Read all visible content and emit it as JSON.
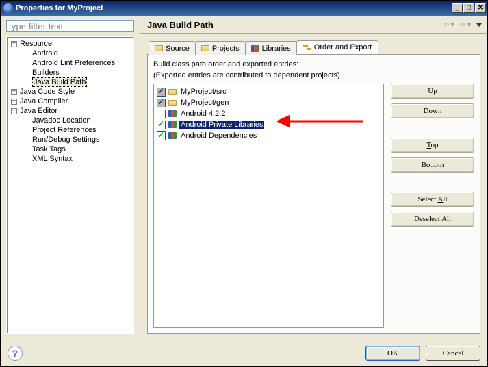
{
  "titlebar": {
    "title": "Properties for MyProject"
  },
  "filter": {
    "placeholder": "type filter text"
  },
  "tree": [
    {
      "label": "Resource",
      "indent": 0,
      "exp": "+"
    },
    {
      "label": "Android",
      "indent": 1,
      "exp": ""
    },
    {
      "label": "Android Lint Preferences",
      "indent": 1,
      "exp": ""
    },
    {
      "label": "Builders",
      "indent": 1,
      "exp": ""
    },
    {
      "label": "Java Build Path",
      "indent": 1,
      "exp": "",
      "selected": true
    },
    {
      "label": "Java Code Style",
      "indent": 0,
      "exp": "+"
    },
    {
      "label": "Java Compiler",
      "indent": 0,
      "exp": "+"
    },
    {
      "label": "Java Editor",
      "indent": 0,
      "exp": "+"
    },
    {
      "label": "Javadoc Location",
      "indent": 1,
      "exp": ""
    },
    {
      "label": "Project References",
      "indent": 1,
      "exp": ""
    },
    {
      "label": "Run/Debug Settings",
      "indent": 1,
      "exp": ""
    },
    {
      "label": "Task Tags",
      "indent": 1,
      "exp": ""
    },
    {
      "label": "XML Syntax",
      "indent": 1,
      "exp": ""
    }
  ],
  "header": {
    "title": "Java Build Path"
  },
  "tabs": {
    "source": "Source",
    "projects": "Projects",
    "libraries": "Libraries",
    "order": "Order and Export"
  },
  "panel": {
    "help1": "Build class path order and exported entries:",
    "help2": "(Exported entries are contributed to dependent projects)",
    "items": [
      {
        "label": "MyProject/src",
        "checked": true,
        "locked": true,
        "icon": "folder"
      },
      {
        "label": "MyProject/gen",
        "checked": true,
        "locked": true,
        "icon": "folder"
      },
      {
        "label": "Android 4.2.2",
        "checked": false,
        "locked": false,
        "icon": "lib"
      },
      {
        "label": "Android Private Libraries",
        "checked": true,
        "locked": false,
        "icon": "lib",
        "selected": true
      },
      {
        "label": "Android Dependencies",
        "checked": true,
        "locked": false,
        "icon": "lib"
      }
    ]
  },
  "buttons": {
    "up": "Up",
    "down": "Down",
    "top": "Top",
    "bottom": "Bottom",
    "selectall": "Select All",
    "deselectall": "Deselect All",
    "ok": "OK",
    "cancel": "Cancel"
  }
}
